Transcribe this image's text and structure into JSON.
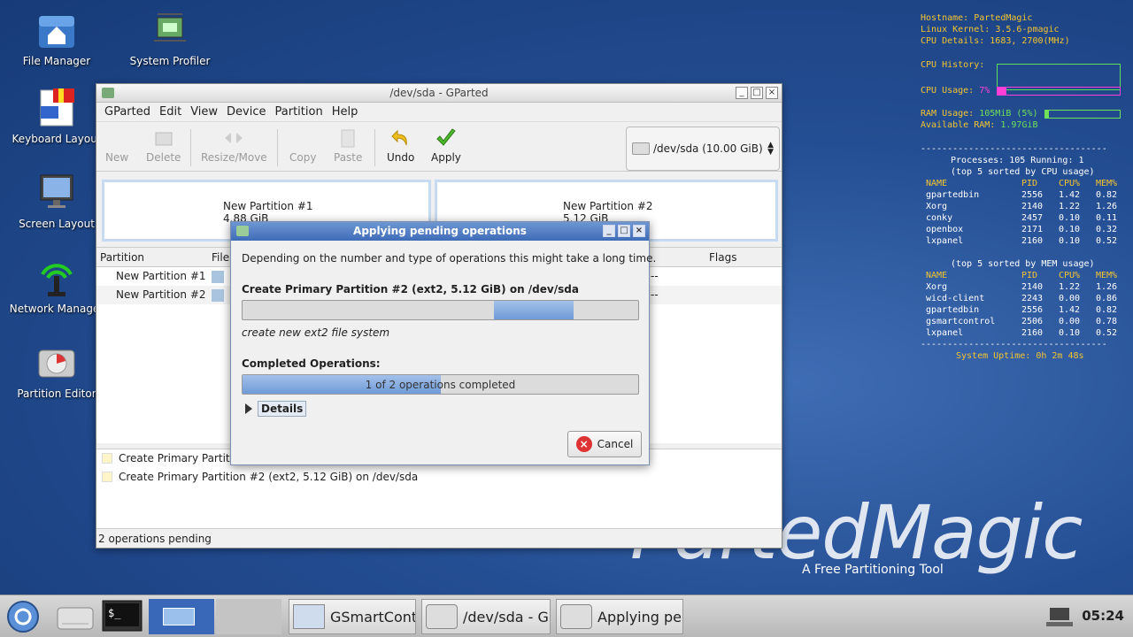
{
  "desktop": {
    "icons": [
      {
        "label": "File Manager"
      },
      {
        "label": "System Profiler"
      },
      {
        "label": "Keyboard Layout"
      },
      {
        "label": "Screen Layout"
      },
      {
        "label": "Network Manager"
      },
      {
        "label": "Partition Editor"
      }
    ],
    "brand": {
      "logo_text": "PartedMagic",
      "tagline": "A Free Partitioning Tool"
    }
  },
  "conky": {
    "hostname_label": "Hostname:",
    "hostname": "PartedMagic",
    "kernel_label": "Linux Kernel:",
    "kernel": "3.5.6-pmagic",
    "cpu_details_label": "CPU Details:",
    "cpu_details": "1683, 2700(MHz)",
    "cpu_history_label": "CPU History:",
    "cpu_usage_label": "CPU Usage:",
    "cpu_usage": "7%",
    "cpu_usage_fraction": 0.07,
    "ram_usage_label": "RAM Usage:",
    "ram_usage": "105MiB (5%)",
    "ram_usage_fraction": 0.05,
    "available_ram_label": "Available RAM:",
    "available_ram": "1.97GiB",
    "separator": "-----------------------------------",
    "processes_line": "Processes: 105  Running: 1",
    "top_cpu_title": "(top 5 sorted by CPU usage)",
    "top_mem_title": "(top 5 sorted by MEM usage)",
    "columns": [
      "NAME",
      "PID",
      "CPU%",
      "MEM%"
    ],
    "top_cpu": [
      [
        "gpartedbin",
        "2556",
        "1.42",
        "0.82"
      ],
      [
        "Xorg",
        "2140",
        "1.22",
        "1.26"
      ],
      [
        "conky",
        "2457",
        "0.10",
        "0.11"
      ],
      [
        "openbox",
        "2171",
        "0.10",
        "0.32"
      ],
      [
        "lxpanel",
        "2160",
        "0.10",
        "0.52"
      ]
    ],
    "top_mem": [
      [
        "Xorg",
        "2140",
        "1.22",
        "1.26"
      ],
      [
        "wicd-client",
        "2243",
        "0.00",
        "0.86"
      ],
      [
        "gpartedbin",
        "2556",
        "1.42",
        "0.82"
      ],
      [
        "gsmartcontrol",
        "2506",
        "0.00",
        "0.78"
      ],
      [
        "lxpanel",
        "2160",
        "0.10",
        "0.52"
      ]
    ],
    "uptime_label": "System Uptime:",
    "uptime": "0h 2m 48s",
    "colors": {
      "label": "#f4c430",
      "value": "#6ee05a",
      "cpu_bar": "#ff3fd8"
    }
  },
  "gparted": {
    "title": "/dev/sda - GParted",
    "menu": [
      "GParted",
      "Edit",
      "View",
      "Device",
      "Partition",
      "Help"
    ],
    "toolbar": {
      "new": "New",
      "delete": "Delete",
      "resize_move": "Resize/Move",
      "copy": "Copy",
      "paste": "Paste",
      "undo": "Undo",
      "apply": "Apply"
    },
    "device": "/dev/sda   (10.00 GiB)",
    "partitions_map": [
      {
        "name": "New Partition #1",
        "size": "4.88 GiB"
      },
      {
        "name": "New Partition #2",
        "size": "5.12 GiB"
      }
    ],
    "table_headers": {
      "partition": "Partition",
      "file": "File",
      "flags": "Flags"
    },
    "rows": [
      {
        "name": "New Partition #1",
        "dash": "--"
      },
      {
        "name": "New Partition #2",
        "dash": "--"
      }
    ],
    "operations": [
      "Create Primary Partition #1 (ext2, 4.88 GiB) on /dev/sda",
      "Create Primary Partition #2 (ext2, 5.12 GiB) on /dev/sda"
    ],
    "status": "2 operations pending"
  },
  "dialog": {
    "title": "Applying pending operations",
    "info": "Depending on the number and type of operations this might take a long time.",
    "current_op": "Create Primary Partition #2 (ext2, 5.12 GiB) on /dev/sda",
    "sub_op": "create new ext2 file system",
    "completed_label": "Completed Operations:",
    "completed_text": "1 of 2 operations completed",
    "completed_fraction": 0.5,
    "details": "Details",
    "cancel": "Cancel"
  },
  "taskbar": {
    "tasks": [
      "GSmartCont...",
      "/dev/sda - G...",
      "Applying pe..."
    ],
    "clock": "05:24"
  }
}
